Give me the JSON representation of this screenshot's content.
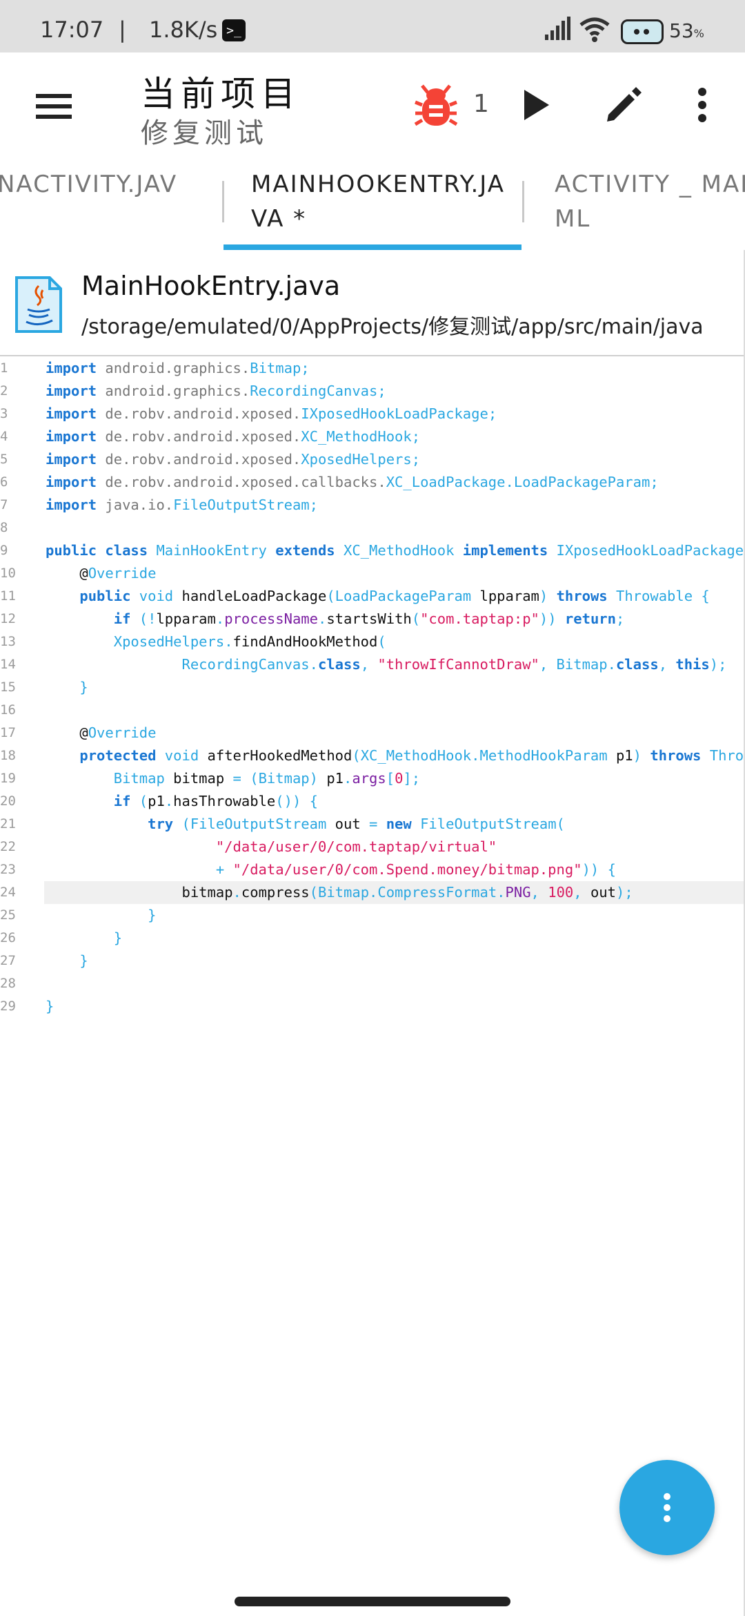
{
  "status_bar": {
    "time": "17:07",
    "separator": "|",
    "net_speed": "1.8K/s",
    "battery_percent": "53",
    "battery_unit": "%"
  },
  "app_bar": {
    "title": "当前项目",
    "subtitle": "修复测试",
    "bug_count": "1",
    "bug_icon_color": "#f44336"
  },
  "tabs": [
    {
      "label": "NACTIVITY.JAV",
      "active": false
    },
    {
      "label": "MAINHOOKENTRY.JA VA *",
      "active": true
    },
    {
      "label": "ACTIVITY _ MAI ML",
      "active": false
    }
  ],
  "file": {
    "name": "MainHookEntry.java",
    "path": "/storage/emulated/0/AppProjects/修复测试/app/src/main/java"
  },
  "editor": {
    "current_line": 24,
    "lines": [
      {
        "n": "1"
      },
      {
        "n": "2"
      },
      {
        "n": "3"
      },
      {
        "n": "4"
      },
      {
        "n": "5"
      },
      {
        "n": "6"
      },
      {
        "n": "7"
      },
      {
        "n": "8"
      },
      {
        "n": "9"
      },
      {
        "n": "10"
      },
      {
        "n": "11"
      },
      {
        "n": "12"
      },
      {
        "n": "13"
      },
      {
        "n": "14"
      },
      {
        "n": "15"
      },
      {
        "n": "16"
      },
      {
        "n": "17"
      },
      {
        "n": "18"
      },
      {
        "n": "19"
      },
      {
        "n": "20"
      },
      {
        "n": "21"
      },
      {
        "n": "22"
      },
      {
        "n": "23"
      },
      {
        "n": "24"
      },
      {
        "n": "25"
      },
      {
        "n": "26"
      },
      {
        "n": "27"
      },
      {
        "n": "28"
      },
      {
        "n": "29"
      }
    ],
    "tokens": {
      "l1": [
        "import",
        " android.graphics.",
        "Bitmap",
        ";"
      ],
      "l2": [
        "import",
        " android.graphics.",
        "RecordingCanvas",
        ";"
      ],
      "l3": [
        "import",
        " de.robv.android.xposed.",
        "IXposedHookLoadPackage",
        ";"
      ],
      "l4": [
        "import",
        " de.robv.android.xposed.",
        "XC_MethodHook",
        ";"
      ],
      "l5": [
        "import",
        " de.robv.android.xposed.",
        "XposedHelpers",
        ";"
      ],
      "l6": [
        "import",
        " de.robv.android.xposed.callbacks.",
        "XC_LoadPackage.LoadPackageParam",
        ";"
      ],
      "l7": [
        "import",
        " java.io.",
        "FileOutputStream",
        ";"
      ],
      "l9": [
        "public class",
        " MainHookEntry ",
        "extends",
        " XC_MethodHook ",
        "implements",
        " IXposedHookLoadPackage {"
      ],
      "l10": [
        "@",
        "Override"
      ],
      "l11": [
        "public",
        " void ",
        "handleLoadPackage",
        "(LoadPackageParam ",
        "lpparam",
        ") ",
        "throws",
        " Throwable {"
      ],
      "l12": [
        "if",
        " (!",
        "lpparam",
        ".",
        "processName",
        ".",
        "startsWith",
        "(",
        "\"com.taptap:p\"",
        ")) ",
        "return",
        ";"
      ],
      "l13": [
        "XposedHelpers",
        ".",
        "findAndHookMethod",
        "("
      ],
      "l14": [
        "RecordingCanvas.",
        "class",
        ", ",
        "\"throwIfCannotDraw\"",
        ", Bitmap.",
        "class",
        ", ",
        "this",
        ");"
      ],
      "l15": [
        "}"
      ],
      "l17": [
        "@",
        "Override"
      ],
      "l18": [
        "protected",
        " void ",
        "afterHookedMethod",
        "(XC_MethodHook.MethodHookParam ",
        "p1",
        ") ",
        "throws",
        " Throwab"
      ],
      "l19": [
        "Bitmap ",
        "bitmap",
        " = (Bitmap) ",
        "p1",
        ".",
        "args",
        "[",
        "0",
        "];"
      ],
      "l20": [
        "if",
        " (",
        "p1",
        ".",
        "hasThrowable",
        "()) {"
      ],
      "l21": [
        "try",
        " (FileOutputStream ",
        "out",
        " = ",
        "new",
        " FileOutputStream("
      ],
      "l22": [
        "\"/data/user/0/com.taptap/virtual\""
      ],
      "l23": [
        "+ ",
        "\"/data/user/0/com.Spend.money/bitmap.png\"",
        ")) {"
      ],
      "l24": [
        "bitmap",
        ".",
        "compress",
        "(Bitmap.CompressFormat.",
        "PNG",
        ", ",
        "100",
        ", ",
        "out",
        ");"
      ],
      "l25": [
        "}"
      ],
      "l26": [
        "}"
      ],
      "l27": [
        "}"
      ],
      "l29": [
        "}"
      ]
    }
  },
  "fab": {
    "icon": "more-vert-icon"
  },
  "colors": {
    "accent": "#2aa7e1",
    "keyword": "#1976d2",
    "string": "#d81b60",
    "status_bar_bg": "#e0e0e0"
  }
}
